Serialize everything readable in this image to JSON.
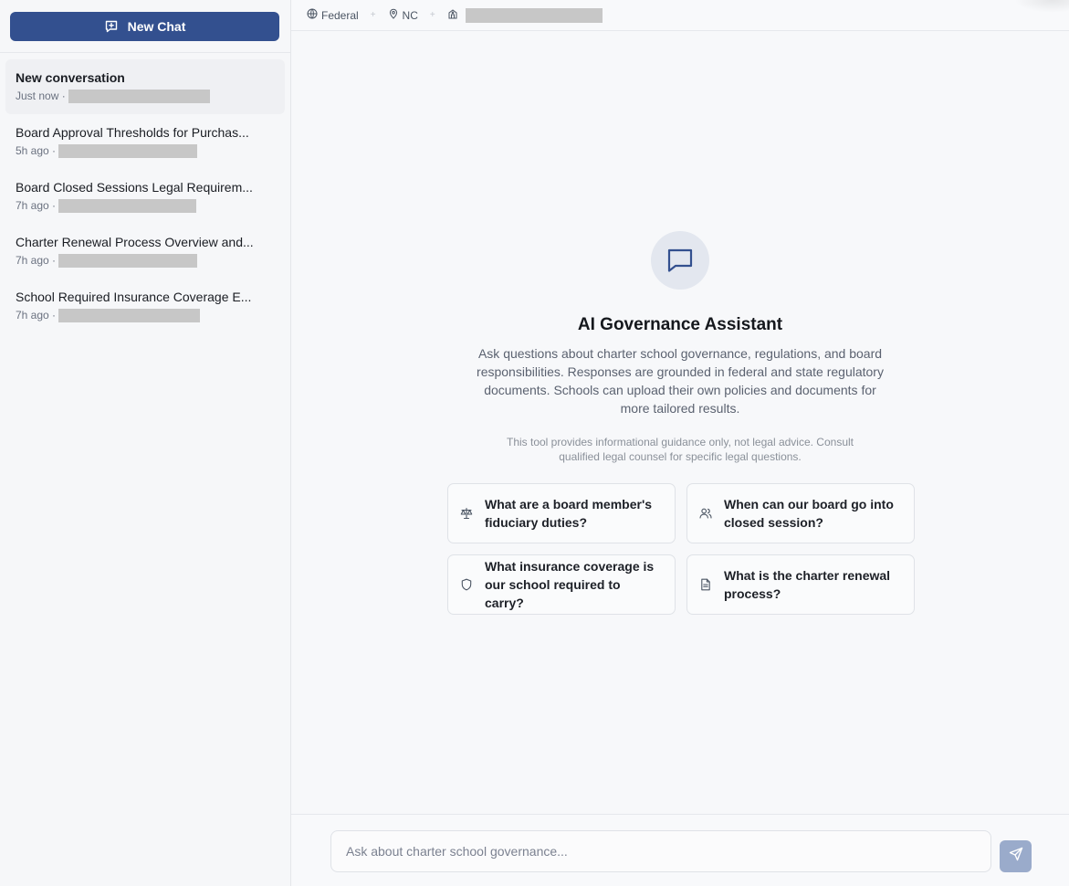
{
  "sidebar": {
    "new_chat_label": "New Chat",
    "conversations": [
      {
        "title": "New conversation",
        "time": "Just now ·",
        "active": true
      },
      {
        "title": "Board Approval Thresholds for Purchas...",
        "time": "5h ago ·",
        "active": false
      },
      {
        "title": "Board Closed Sessions Legal Requirem...",
        "time": "7h ago ·",
        "active": false
      },
      {
        "title": "Charter Renewal Process Overview and...",
        "time": "7h ago ·",
        "active": false
      },
      {
        "title": "School Required Insurance Coverage E...",
        "time": "7h ago ·",
        "active": false
      }
    ]
  },
  "topbar": {
    "jurisdiction_federal": "Federal",
    "separator": "+",
    "state": "NC"
  },
  "hero": {
    "title": "AI Governance Assistant",
    "description": "Ask questions about charter school governance, regulations, and board responsibilities. Responses are grounded in federal and state regulatory documents. Schools can upload their own policies and documents for more tailored results.",
    "disclaimer": "This tool provides informational guidance only, not legal advice. Consult qualified legal counsel for specific legal questions."
  },
  "suggestions": [
    {
      "text": "What are a board member's fiduciary duties?",
      "icon": "scale-icon"
    },
    {
      "text": "When can our board go into closed session?",
      "icon": "users-icon"
    },
    {
      "text": "What insurance coverage is our school required to carry?",
      "icon": "shield-icon"
    },
    {
      "text": "What is the charter renewal process?",
      "icon": "document-icon"
    }
  ],
  "composer": {
    "placeholder": "Ask about charter school governance...",
    "value": ""
  },
  "colors": {
    "accent": "#33508f",
    "send_button_disabled": "#9aabcb",
    "redaction": "#c7c7c7"
  }
}
